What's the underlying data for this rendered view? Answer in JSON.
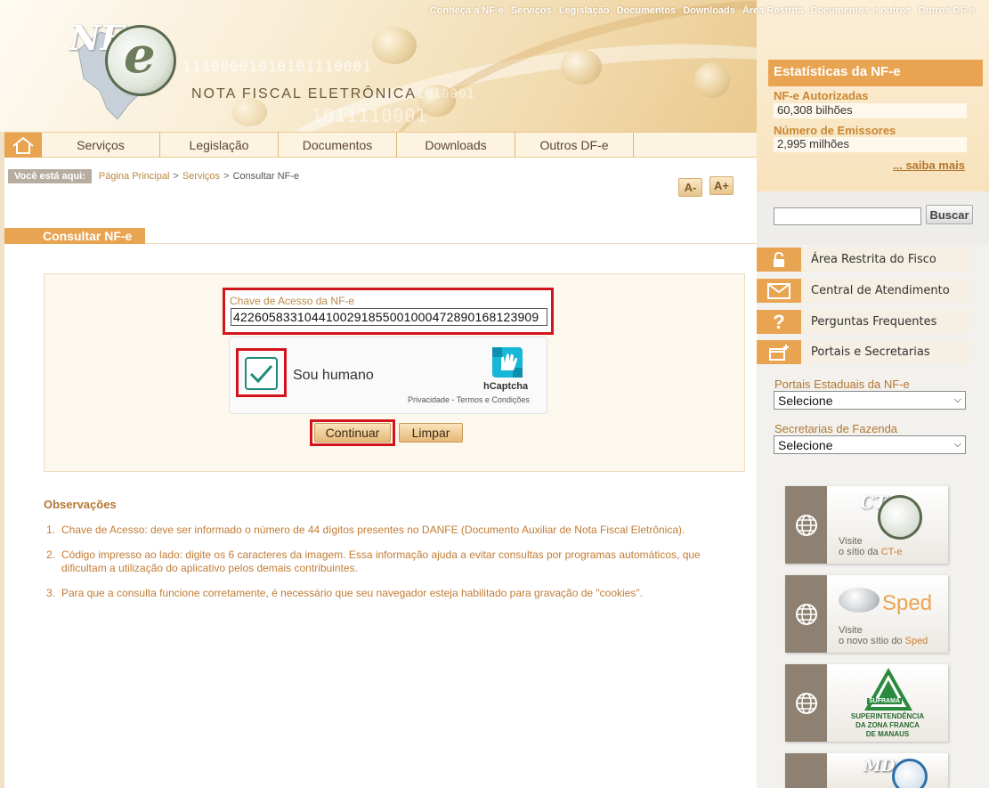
{
  "topnav": [
    "Conheça a NF-e",
    "Serviços",
    "Legislação",
    "Documentos",
    "Downloads",
    "Área Restrita",
    "Documentos e outros",
    "Outros DF-e"
  ],
  "logo": {
    "nf": "NF",
    "e": "e",
    "subtitle": "NOTA FISCAL ELETRÔNICA",
    "binary1": "11100001010101110001",
    "binary2": "1011110001",
    "binary3": "01111010001"
  },
  "mainnav": [
    "Serviços",
    "Legislação",
    "Documentos",
    "Downloads",
    "Outros DF-e"
  ],
  "breadcrumb": {
    "label": "Você está aqui:",
    "home": "Página Principal",
    "section": "Serviços",
    "current": "Consultar NF-e",
    "sep": ">"
  },
  "font_controls": {
    "decrease": "A-",
    "increase": "A+"
  },
  "page": {
    "title": "Consultar NF-e"
  },
  "form": {
    "key_label": "Chave de Acesso da NF-e",
    "key_value": "42260583310441002918550010004728901681239​09",
    "captcha_label": "Sou humano",
    "captcha_brand": "hCaptcha",
    "captcha_links": "Privacidade - Termos e Condições",
    "continue": "Continuar",
    "clear": "Limpar"
  },
  "observations": {
    "title": "Observações",
    "items": [
      {
        "n": "1.",
        "text": "Chave de Acesso: deve ser informado o número de 44 dígitos presentes no DANFE (Documento Auxiliar de Nota Fiscal Eletrônica)."
      },
      {
        "n": "2.",
        "text": "Código impresso ao lado: digite os 6 caracteres da imagem. Essa informação ajuda a evitar consultas por programas automáticos, que dificultam a utilização do aplicativo pelos demais contribuintes."
      },
      {
        "n": "3.",
        "text": "Para que a consulta funcione corretamente, é necessário que seu navegador esteja habilitado para gravação de \"cookies\"."
      }
    ]
  },
  "sidebar": {
    "stats_title": "Estatísticas da NF-e",
    "authorized_label": "NF-e Autorizadas",
    "authorized_value": "60,308 bilhões",
    "issuers_label": "Número de Emissores",
    "issuers_value": "2,995 milhões",
    "more": "... saiba mais",
    "search_button": "Buscar",
    "links": [
      "Área Restrita do Fisco",
      "Central de Atendimento",
      "Perguntas Frequentes",
      "Portais e Secretarias"
    ],
    "state_portals_label": "Portais Estaduais da NF-e",
    "state_portals_value": "Selecione",
    "treasury_label": "Secretarias de Fazenda",
    "treasury_value": "Selecione",
    "banners": {
      "cte": {
        "logo": "CT",
        "visit": "Visite",
        "site_pre": "o sítio da ",
        "site_name": "CT-e"
      },
      "sped": {
        "logo": "Sped",
        "visit": "Visite",
        "site_pre": "o novo sítio do ",
        "site_name": "Sped"
      },
      "suframa": {
        "logo": "SUFRAMA",
        "line1": "SUPERINTENDÊNCIA",
        "line2": "DA ZONA FRANCA",
        "line3": "DE MANAUS"
      },
      "mdfe": {
        "logo": "MDF"
      }
    }
  }
}
